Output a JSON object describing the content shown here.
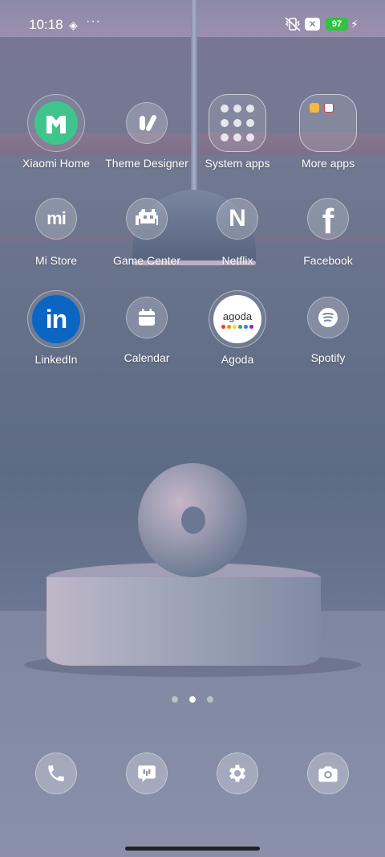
{
  "status_bar": {
    "time": "10:18",
    "battery": "97",
    "more": "···",
    "x_badge": "✕"
  },
  "apps": [
    {
      "label": "Xiaomi Home",
      "icon": "xiaomi-home-icon"
    },
    {
      "label": "Theme Designer",
      "icon": "theme-designer-icon"
    },
    {
      "label": "System apps",
      "icon": "system-apps-folder-icon"
    },
    {
      "label": "More apps",
      "icon": "more-apps-folder-icon"
    },
    {
      "label": "Mi Store",
      "icon": "mi-store-icon"
    },
    {
      "label": "Game Center",
      "icon": "game-center-icon"
    },
    {
      "label": "Netflix",
      "icon": "netflix-icon"
    },
    {
      "label": "Facebook",
      "icon": "facebook-icon"
    },
    {
      "label": "LinkedIn",
      "icon": "linkedin-icon"
    },
    {
      "label": "Calendar",
      "icon": "calendar-icon"
    },
    {
      "label": "Agoda",
      "icon": "agoda-icon"
    },
    {
      "label": "Spotify",
      "icon": "spotify-icon"
    }
  ],
  "icon_text": {
    "mi": "mi",
    "netflix": "N",
    "facebook": "f",
    "linkedin": "in",
    "agoda": "agoda"
  },
  "page_indicator": {
    "pages": 3,
    "active": 2
  },
  "dock": [
    {
      "icon": "phone-icon"
    },
    {
      "icon": "messages-icon"
    },
    {
      "icon": "settings-icon"
    },
    {
      "icon": "camera-icon"
    }
  ],
  "colors": {
    "battery": "#32c244",
    "xiaomi_home": "#3ec48c",
    "linkedin": "#0a66c2",
    "agoda_dots": [
      "#e53935",
      "#fb8c00",
      "#fdd835",
      "#43a047",
      "#1e88e5",
      "#8e24aa"
    ]
  }
}
